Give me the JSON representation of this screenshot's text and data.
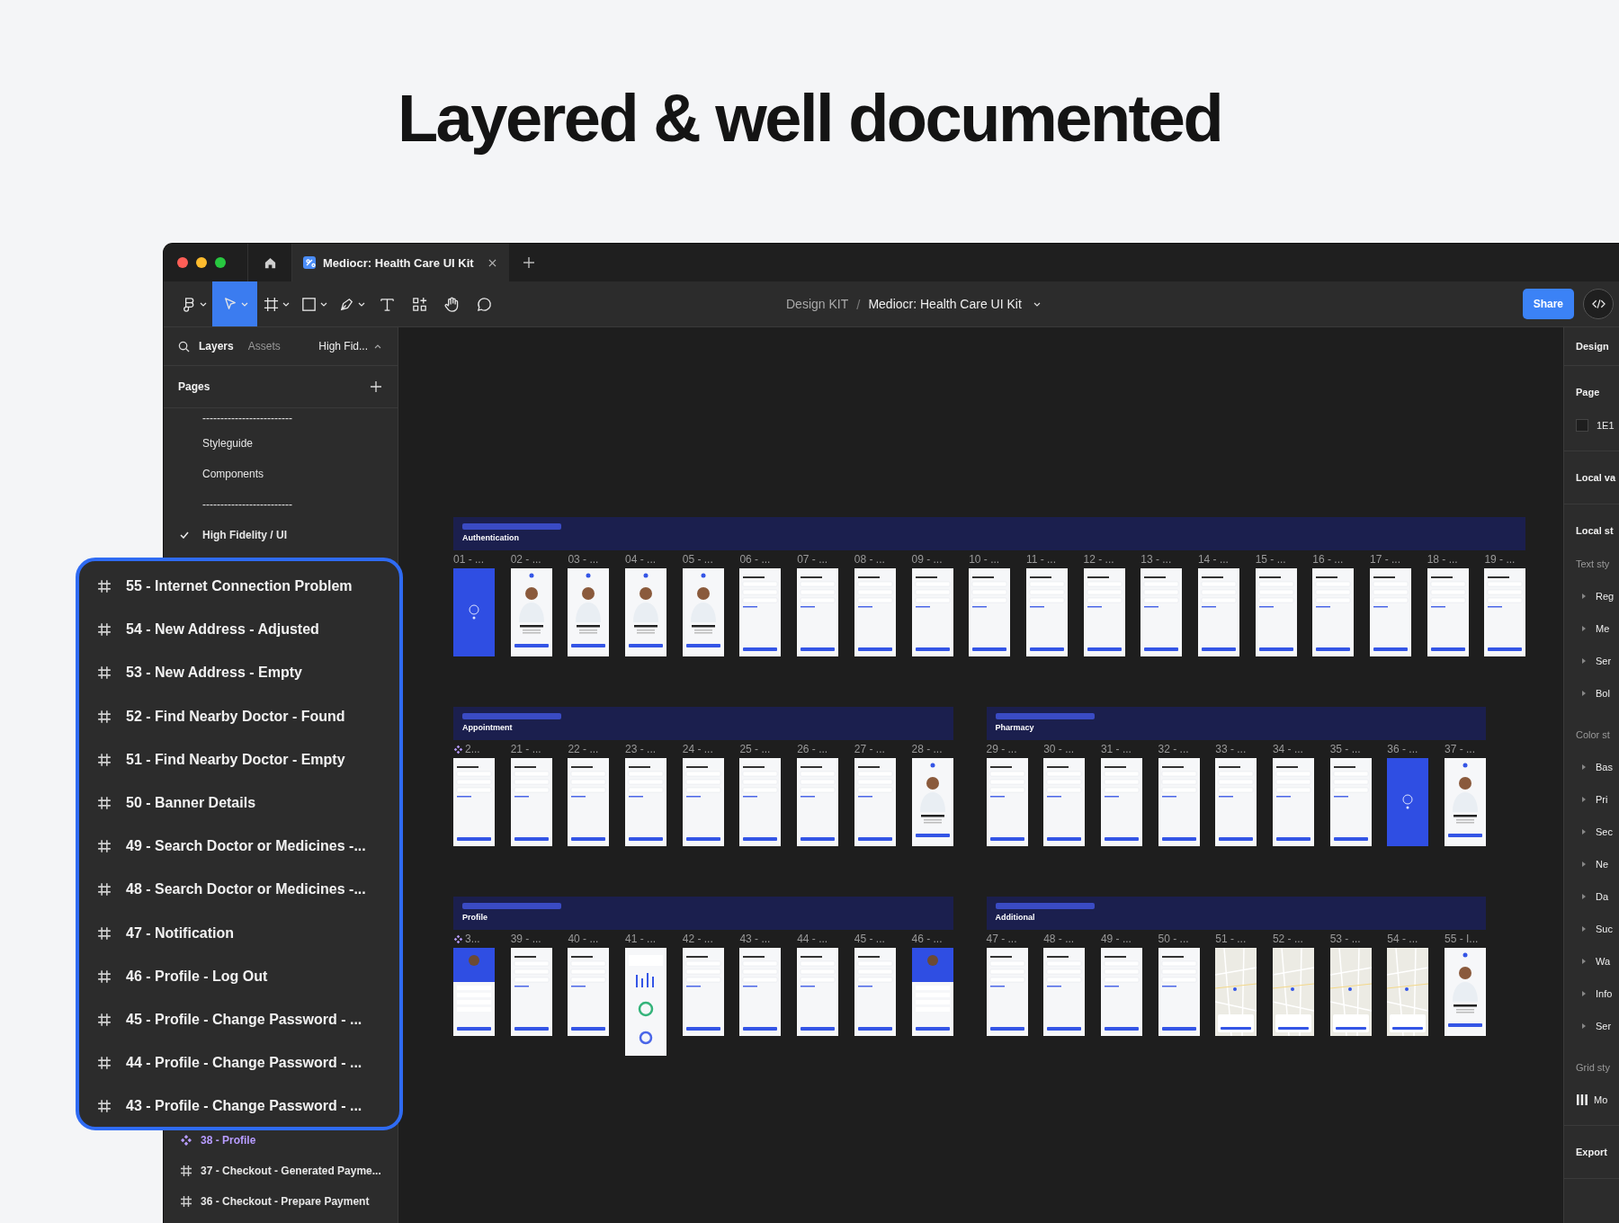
{
  "headline": "Layered & well documented",
  "window": {
    "tabs": [
      {
        "title": "Mediocr: Health Care UI Kit",
        "selected": true
      }
    ],
    "tools": [
      {
        "kind": "main-menu",
        "caret": true,
        "selected": false
      },
      {
        "kind": "move",
        "caret": true,
        "selected": true
      },
      {
        "kind": "frame",
        "caret": true,
        "selected": false
      },
      {
        "kind": "shape",
        "caret": true,
        "selected": false
      },
      {
        "kind": "pen",
        "caret": true,
        "selected": false
      },
      {
        "kind": "text",
        "caret": false,
        "selected": false
      },
      {
        "kind": "resources",
        "caret": false,
        "selected": false
      },
      {
        "kind": "hand",
        "caret": false,
        "selected": false
      },
      {
        "kind": "comment",
        "caret": false,
        "selected": false
      }
    ],
    "breadcrumb": {
      "project": "Design KIT",
      "separator": "/",
      "file": "Mediocr: Health Care UI Kit"
    },
    "share_button": "Share"
  },
  "layers_panel": {
    "tabs": [
      {
        "label": "Layers",
        "selected": true
      },
      {
        "label": "Assets",
        "selected": false
      }
    ],
    "page_switcher": "High Fid...",
    "pages_header": "Pages",
    "pages": [
      {
        "label": "-------------------------",
        "current": false
      },
      {
        "label": "Styleguide",
        "current": false
      },
      {
        "label": "Components",
        "current": false
      },
      {
        "label": "-------------------------",
        "current": false
      },
      {
        "label": "High Fidelity / UI",
        "current": true
      }
    ],
    "layers": [
      {
        "label": "38 - Profile",
        "kind": "component"
      },
      {
        "label": "37 - Checkout - Generated Payme...",
        "kind": "frame"
      },
      {
        "label": "36 - Checkout - Prepare Payment",
        "kind": "frame"
      }
    ]
  },
  "callout": {
    "layers": [
      {
        "label": "55 - Internet Connection Problem",
        "kind": "frame"
      },
      {
        "label": "54 - New Address - Adjusted",
        "kind": "frame"
      },
      {
        "label": "53 - New Address - Empty",
        "kind": "frame"
      },
      {
        "label": "52 - Find Nearby Doctor - Found",
        "kind": "frame"
      },
      {
        "label": "51 - Find Nearby Doctor - Empty",
        "kind": "frame"
      },
      {
        "label": "50 - Banner Details",
        "kind": "frame"
      },
      {
        "label": "49 - Search Doctor or Medicines -...",
        "kind": "frame"
      },
      {
        "label": "48 - Search Doctor or Medicines -...",
        "kind": "frame"
      },
      {
        "label": "47 - Notification",
        "kind": "frame"
      },
      {
        "label": "46 - Profile - Log Out",
        "kind": "frame"
      },
      {
        "label": "45 - Profile - Change Password - ...",
        "kind": "frame"
      },
      {
        "label": "44 - Profile - Change Password - ...",
        "kind": "frame"
      },
      {
        "label": "43 - Profile - Change Password - ...",
        "kind": "frame"
      }
    ]
  },
  "canvas": {
    "rows": [
      {
        "sections": [
          {
            "title": "Authentication",
            "frames": [
              {
                "label": "01 - ...",
                "kind": "splash",
                "component": false
              },
              {
                "label": "02 - ...",
                "kind": "photo",
                "component": false
              },
              {
                "label": "03 - ...",
                "kind": "photo",
                "component": false
              },
              {
                "label": "04 - ...",
                "kind": "photo",
                "component": false
              },
              {
                "label": "05 - ...",
                "kind": "photo",
                "component": false
              },
              {
                "label": "06 - ...",
                "kind": "form",
                "component": false
              },
              {
                "label": "07 - ...",
                "kind": "form",
                "component": false
              },
              {
                "label": "08 - ...",
                "kind": "form",
                "component": false
              },
              {
                "label": "09 - ...",
                "kind": "form",
                "component": false
              },
              {
                "label": "10 - ...",
                "kind": "form",
                "component": false
              },
              {
                "label": "11 - ...",
                "kind": "form",
                "component": false
              },
              {
                "label": "12 - ...",
                "kind": "form",
                "component": false
              },
              {
                "label": "13 - ...",
                "kind": "form",
                "component": false
              },
              {
                "label": "14 - ...",
                "kind": "form",
                "component": false
              },
              {
                "label": "15 - ...",
                "kind": "form",
                "component": false
              },
              {
                "label": "16 - ...",
                "kind": "form",
                "component": false
              },
              {
                "label": "17 - ...",
                "kind": "form",
                "component": false
              },
              {
                "label": "18 - ...",
                "kind": "form",
                "component": false
              },
              {
                "label": "19 - ...",
                "kind": "form",
                "component": false
              }
            ]
          }
        ]
      },
      {
        "sections": [
          {
            "title": "Appointment",
            "frames": [
              {
                "label": "2...",
                "kind": "form",
                "component": true
              },
              {
                "label": "21 - ...",
                "kind": "form",
                "component": false
              },
              {
                "label": "22 - ...",
                "kind": "form",
                "component": false
              },
              {
                "label": "23 - ...",
                "kind": "form",
                "component": false
              },
              {
                "label": "24 - ...",
                "kind": "form",
                "component": false
              },
              {
                "label": "25 - ...",
                "kind": "form",
                "component": false
              },
              {
                "label": "26 - ...",
                "kind": "form",
                "component": false
              },
              {
                "label": "27 - ...",
                "kind": "form",
                "component": false
              },
              {
                "label": "28 - ...",
                "kind": "photo",
                "component": false
              }
            ]
          },
          {
            "title": "Pharmacy",
            "frames": [
              {
                "label": "29 - ...",
                "kind": "form",
                "component": false
              },
              {
                "label": "30 - ...",
                "kind": "form",
                "component": false
              },
              {
                "label": "31 - ...",
                "kind": "form",
                "component": false
              },
              {
                "label": "32 - ...",
                "kind": "form",
                "component": false
              },
              {
                "label": "33 - ...",
                "kind": "form",
                "component": false
              },
              {
                "label": "34 - ...",
                "kind": "form",
                "component": false
              },
              {
                "label": "35 - ...",
                "kind": "form",
                "component": false
              },
              {
                "label": "36 - ...",
                "kind": "splash",
                "component": false
              },
              {
                "label": "37 - ...",
                "kind": "photo",
                "component": false
              }
            ]
          }
        ]
      },
      {
        "sections": [
          {
            "title": "Profile",
            "frames": [
              {
                "label": "3...",
                "kind": "profile",
                "component": true
              },
              {
                "label": "39 - ...",
                "kind": "form",
                "component": false
              },
              {
                "label": "40 - ...",
                "kind": "form",
                "component": false
              },
              {
                "label": "41 - ...",
                "kind": "chart",
                "component": false
              },
              {
                "label": "42 - ...",
                "kind": "form",
                "component": false
              },
              {
                "label": "43 - ...",
                "kind": "form",
                "component": false
              },
              {
                "label": "44 - ...",
                "kind": "form",
                "component": false
              },
              {
                "label": "45 - ...",
                "kind": "form",
                "component": false
              },
              {
                "label": "46 - ...",
                "kind": "profile",
                "component": false
              }
            ]
          },
          {
            "title": "Additional",
            "frames": [
              {
                "label": "47 - ...",
                "kind": "form",
                "component": false
              },
              {
                "label": "48 - ...",
                "kind": "form",
                "component": false
              },
              {
                "label": "49 - ...",
                "kind": "form",
                "component": false
              },
              {
                "label": "50 - ...",
                "kind": "form",
                "component": false
              },
              {
                "label": "51 - ...",
                "kind": "map",
                "component": false
              },
              {
                "label": "52 - ...",
                "kind": "map",
                "component": false
              },
              {
                "label": "53 - ...",
                "kind": "map",
                "component": false
              },
              {
                "label": "54 - ...",
                "kind": "map",
                "component": false
              },
              {
                "label": "55 - I...",
                "kind": "photo",
                "component": false
              }
            ]
          }
        ]
      }
    ]
  },
  "design_panel": {
    "tab": "Design",
    "sections": [
      {
        "title": "Page",
        "items": [
          {
            "kind": "swatch",
            "label": "1E1"
          }
        ]
      },
      {
        "title": "Local va"
      },
      {
        "title": "Local st",
        "groups": [
          {
            "title": "Text sty",
            "items": [
              {
                "kind": "style",
                "label": "Reg"
              },
              {
                "kind": "style",
                "label": "Me"
              },
              {
                "kind": "style",
                "label": "Ser"
              },
              {
                "kind": "style",
                "label": "Bol"
              }
            ]
          },
          {
            "title": "Color st",
            "items": [
              {
                "kind": "style",
                "label": "Bas"
              },
              {
                "kind": "style",
                "label": "Pri"
              },
              {
                "kind": "style",
                "label": "Sec"
              },
              {
                "kind": "style",
                "label": "Ne"
              },
              {
                "kind": "style",
                "label": "Da"
              },
              {
                "kind": "style",
                "label": "Suc"
              },
              {
                "kind": "style",
                "label": "Wa"
              },
              {
                "kind": "style",
                "label": "Info"
              },
              {
                "kind": "style",
                "label": "Ser"
              }
            ]
          },
          {
            "title": "Grid sty",
            "items": [
              {
                "kind": "grid",
                "label": "Mo"
              }
            ]
          }
        ]
      },
      {
        "title": "Export"
      }
    ]
  }
}
